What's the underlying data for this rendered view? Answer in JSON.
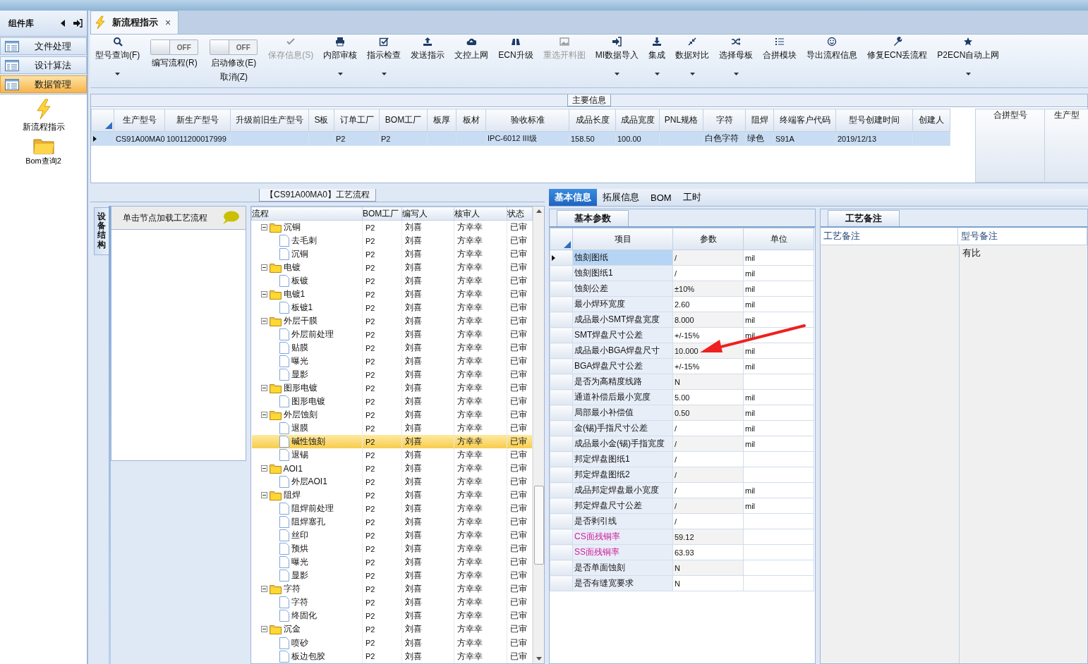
{
  "sidebar": {
    "title": "组件库",
    "items": [
      {
        "label": "文件处理",
        "selected": false
      },
      {
        "label": "设计算法",
        "selected": false
      },
      {
        "label": "数据管理",
        "selected": true
      }
    ],
    "tiles": [
      {
        "label": "新流程指示",
        "kind": "lightning"
      },
      {
        "label": "Bom查询2",
        "kind": "folder"
      }
    ]
  },
  "tabs": [
    {
      "label": "新流程指示",
      "close": "×",
      "selected": true
    }
  ],
  "toolbar": [
    {
      "kind": "button",
      "label": "型号查询(F)",
      "dropdown": true,
      "disabled": false
    },
    {
      "kind": "toggle",
      "text": "OFF",
      "on": false,
      "label": "编写流程(R)"
    },
    {
      "kind": "toggle",
      "text": "OFF",
      "on": false,
      "label": "启动修改(E)",
      "sublabel": "取消(Z)"
    },
    {
      "kind": "button",
      "label": "保存信息(S)",
      "dropdown": false,
      "disabled": true
    },
    {
      "kind": "button",
      "label": "内部审核",
      "dropdown": true,
      "disabled": false
    },
    {
      "kind": "button",
      "label": "指示检查",
      "dropdown": true,
      "disabled": false
    },
    {
      "kind": "button",
      "label": "发送指示",
      "dropdown": false,
      "disabled": false
    },
    {
      "kind": "button",
      "label": "文控上网",
      "dropdown": false,
      "disabled": false
    },
    {
      "kind": "button",
      "label": "ECN升级",
      "dropdown": false,
      "disabled": false
    },
    {
      "kind": "button",
      "label": "重选开料图",
      "dropdown": false,
      "disabled": true
    },
    {
      "kind": "button",
      "label": "MI数据导入",
      "dropdown": true,
      "disabled": false
    },
    {
      "kind": "button",
      "label": "集成",
      "dropdown": true,
      "disabled": false
    },
    {
      "kind": "button",
      "label": "数据对比",
      "dropdown": true,
      "disabled": false
    },
    {
      "kind": "button",
      "label": "选择母板",
      "dropdown": true,
      "disabled": false
    },
    {
      "kind": "button",
      "label": "合拼模块",
      "dropdown": false,
      "disabled": false
    },
    {
      "kind": "button",
      "label": "导出流程信息",
      "dropdown": false,
      "disabled": false
    },
    {
      "kind": "button",
      "label": "修复ECN丢流程",
      "dropdown": false,
      "disabled": false
    },
    {
      "kind": "button",
      "label": "P2ECN自动上网",
      "dropdown": true,
      "disabled": false
    }
  ],
  "main_info": {
    "title": "主要信息",
    "columns": [
      "生产型号",
      "新生产型号",
      "升级前旧生产型号",
      "S板",
      "订单工厂",
      "BOM工厂",
      "板厚",
      "板材",
      "验收标准",
      "成品长度",
      "成品宽度",
      "PNL规格",
      "字符",
      "阻焊",
      "终端客户代码",
      "型号创建时间",
      "创建人"
    ],
    "rows": [
      {
        "selected": true,
        "cells": [
          "CS91A00MA0",
          "10011200017999",
          null,
          null,
          "P2",
          "P2",
          null,
          null,
          "IPC-6012 III级",
          "158.50",
          "100.00",
          null,
          "白色字符",
          "绿色",
          "S91A",
          "2019/12/13",
          null
        ]
      }
    ],
    "side_columns": [
      "合拼型号",
      "生产型"
    ]
  },
  "process_panel": {
    "title": "【CS91A00MA0】工艺流程",
    "side_tab": "设备结构",
    "hint": "单击节点加载工艺流程",
    "columns": [
      "流程",
      "BOM工厂",
      "编写人",
      "核审人",
      "状态"
    ],
    "tree": [
      {
        "name": "沉铜",
        "bom": "P2",
        "writer": "刘喜",
        "reviewer": "方幸幸",
        "status": "已审",
        "selected": false,
        "expanded": true,
        "children": [
          {
            "name": "去毛刺",
            "bom": "P2",
            "writer": "刘喜",
            "reviewer": "方幸幸",
            "status": "已审",
            "selected": false
          },
          {
            "name": "沉铜",
            "bom": "P2",
            "writer": "刘喜",
            "reviewer": "方幸幸",
            "status": "已审",
            "selected": false
          }
        ]
      },
      {
        "name": "电镀",
        "bom": "P2",
        "writer": "刘喜",
        "reviewer": "方幸幸",
        "status": "已审",
        "selected": false,
        "expanded": true,
        "children": [
          {
            "name": "板镀",
            "bom": "P2",
            "writer": "刘喜",
            "reviewer": "方幸幸",
            "status": "已审",
            "selected": false
          }
        ]
      },
      {
        "name": "电镀1",
        "bom": "P2",
        "writer": "刘喜",
        "reviewer": "方幸幸",
        "status": "已审",
        "selected": false,
        "expanded": true,
        "children": [
          {
            "name": "板镀1",
            "bom": "P2",
            "writer": "刘喜",
            "reviewer": "方幸幸",
            "status": "已审",
            "selected": false
          }
        ]
      },
      {
        "name": "外层干膜",
        "bom": "P2",
        "writer": "刘喜",
        "reviewer": "方幸幸",
        "status": "已审",
        "selected": false,
        "expanded": true,
        "children": [
          {
            "name": "外层前处理",
            "bom": "P2",
            "writer": "刘喜",
            "reviewer": "方幸幸",
            "status": "已审",
            "selected": false
          },
          {
            "name": "贴膜",
            "bom": "P2",
            "writer": "刘喜",
            "reviewer": "方幸幸",
            "status": "已审",
            "selected": false
          },
          {
            "name": "曝光",
            "bom": "P2",
            "writer": "刘喜",
            "reviewer": "方幸幸",
            "status": "已审",
            "selected": false
          },
          {
            "name": "显影",
            "bom": "P2",
            "writer": "刘喜",
            "reviewer": "方幸幸",
            "status": "已审",
            "selected": false
          }
        ]
      },
      {
        "name": "图形电镀",
        "bom": "P2",
        "writer": "刘喜",
        "reviewer": "方幸幸",
        "status": "已审",
        "selected": false,
        "expanded": true,
        "children": [
          {
            "name": "图形电镀",
            "bom": "P2",
            "writer": "刘喜",
            "reviewer": "方幸幸",
            "status": "已审",
            "selected": false
          }
        ]
      },
      {
        "name": "外层蚀刻",
        "bom": "P2",
        "writer": "刘喜",
        "reviewer": "方幸幸",
        "status": "已审",
        "selected": false,
        "expanded": true,
        "children": [
          {
            "name": "退膜",
            "bom": "P2",
            "writer": "刘喜",
            "reviewer": "方幸幸",
            "status": "已审",
            "selected": false
          },
          {
            "name": "碱性蚀刻",
            "bom": "P2",
            "writer": "刘喜",
            "reviewer": "方幸幸",
            "status": "已审",
            "selected": true
          },
          {
            "name": "退锡",
            "bom": "P2",
            "writer": "刘喜",
            "reviewer": "方幸幸",
            "status": "已审",
            "selected": false
          }
        ]
      },
      {
        "name": "AOI1",
        "bom": "P2",
        "writer": "刘喜",
        "reviewer": "方幸幸",
        "status": "已审",
        "selected": false,
        "expanded": true,
        "children": [
          {
            "name": "外层AOI1",
            "bom": "P2",
            "writer": "刘喜",
            "reviewer": "方幸幸",
            "status": "已审",
            "selected": false
          }
        ]
      },
      {
        "name": "阻焊",
        "bom": "P2",
        "writer": "刘喜",
        "reviewer": "方幸幸",
        "status": "已审",
        "selected": false,
        "expanded": true,
        "children": [
          {
            "name": "阻焊前处理",
            "bom": "P2",
            "writer": "刘喜",
            "reviewer": "方幸幸",
            "status": "已审",
            "selected": false
          },
          {
            "name": "阻焊塞孔",
            "bom": "P2",
            "writer": "刘喜",
            "reviewer": "方幸幸",
            "status": "已审",
            "selected": false
          },
          {
            "name": "丝印",
            "bom": "P2",
            "writer": "刘喜",
            "reviewer": "方幸幸",
            "status": "已审",
            "selected": false
          },
          {
            "name": "预烘",
            "bom": "P2",
            "writer": "刘喜",
            "reviewer": "方幸幸",
            "status": "已审",
            "selected": false
          },
          {
            "name": "曝光",
            "bom": "P2",
            "writer": "刘喜",
            "reviewer": "方幸幸",
            "status": "已审",
            "selected": false
          },
          {
            "name": "显影",
            "bom": "P2",
            "writer": "刘喜",
            "reviewer": "方幸幸",
            "status": "已审",
            "selected": false
          }
        ]
      },
      {
        "name": "字符",
        "bom": "P2",
        "writer": "刘喜",
        "reviewer": "方幸幸",
        "status": "已审",
        "selected": false,
        "expanded": true,
        "children": [
          {
            "name": "字符",
            "bom": "P2",
            "writer": "刘喜",
            "reviewer": "方幸幸",
            "status": "已审",
            "selected": false
          },
          {
            "name": "终固化",
            "bom": "P2",
            "writer": "刘喜",
            "reviewer": "方幸幸",
            "status": "已审",
            "selected": false
          }
        ]
      },
      {
        "name": "沉金",
        "bom": "P2",
        "writer": "刘喜",
        "reviewer": "方幸幸",
        "status": "已审",
        "selected": false,
        "expanded": true,
        "children": [
          {
            "name": "喷砂",
            "bom": "P2",
            "writer": "刘喜",
            "reviewer": "方幸幸",
            "status": "已审",
            "selected": false
          },
          {
            "name": "板边包胶",
            "bom": "P2",
            "writer": "刘喜",
            "reviewer": "方幸幸",
            "status": "已审",
            "selected": false
          }
        ]
      }
    ]
  },
  "detail_tabs": [
    {
      "label": "基本信息",
      "selected": true
    },
    {
      "label": "拓展信息",
      "selected": false
    },
    {
      "label": "BOM",
      "selected": false
    },
    {
      "label": "工时",
      "selected": false
    }
  ],
  "params": {
    "title": "基本参数",
    "columns": [
      "项目",
      "参数",
      "单位"
    ],
    "rows": [
      {
        "name": "蚀刻图纸",
        "value": "/",
        "unit": "mil",
        "marked": false,
        "selected": true
      },
      {
        "name": "蚀刻图纸1",
        "value": "/",
        "unit": "mil",
        "marked": false,
        "selected": false
      },
      {
        "name": "蚀刻公差",
        "value": "±10%",
        "unit": "mil",
        "marked": false,
        "selected": false
      },
      {
        "name": "最小焊环宽度",
        "value": "2.60",
        "unit": "mil",
        "marked": false,
        "selected": false
      },
      {
        "name": "成品最小SMT焊盘宽度",
        "value": "8.000",
        "unit": "mil",
        "marked": false,
        "selected": false
      },
      {
        "name": "SMT焊盘尺寸公差",
        "value": "+/-15%",
        "unit": "mil",
        "marked": false,
        "selected": false
      },
      {
        "name": "成品最小BGA焊盘尺寸",
        "value": "10.000",
        "unit": "mil",
        "marked": false,
        "selected": false
      },
      {
        "name": "BGA焊盘尺寸公差",
        "value": "+/-15%",
        "unit": "mil",
        "marked": false,
        "selected": false
      },
      {
        "name": "是否为高精度线路",
        "value": "N",
        "marked": false,
        "selected": false
      },
      {
        "name": "通道补偿后最小宽度",
        "value": "5.00",
        "unit": "mil",
        "marked": false,
        "selected": false
      },
      {
        "name": "局部最小补偿值",
        "value": "0.50",
        "unit": "mil",
        "marked": false,
        "selected": false
      },
      {
        "name": "金(锡)手指尺寸公差",
        "value": "/",
        "unit": "mil",
        "marked": false,
        "selected": false
      },
      {
        "name": "成品最小金(锡)手指宽度",
        "value": "/",
        "unit": "mil",
        "marked": false,
        "selected": false
      },
      {
        "name": "邦定焊盘图纸1",
        "value": "/",
        "marked": false,
        "selected": false
      },
      {
        "name": "邦定焊盘图纸2",
        "value": "/",
        "marked": false,
        "selected": false
      },
      {
        "name": "成品邦定焊盘最小宽度",
        "value": "/",
        "unit": "mil",
        "marked": false,
        "selected": false
      },
      {
        "name": "邦定焊盘尺寸公差",
        "value": "/",
        "unit": "mil",
        "marked": false,
        "selected": false
      },
      {
        "name": "是否剥引线",
        "value": "/",
        "marked": false,
        "selected": false
      },
      {
        "name": "CS面残铜率",
        "value": "59.12",
        "marked": true,
        "selected": false
      },
      {
        "name": "SS面残铜率",
        "value": "63.93",
        "marked": true,
        "selected": false
      },
      {
        "name": "是否单面蚀刻",
        "value": "N",
        "marked": false,
        "selected": false
      },
      {
        "name": "是否有缝宽要求",
        "value": "N",
        "marked": false,
        "selected": false
      }
    ]
  },
  "notes": {
    "title": "工艺备注",
    "columns": [
      "工艺备注",
      "型号备注"
    ],
    "model_note": "有比"
  }
}
